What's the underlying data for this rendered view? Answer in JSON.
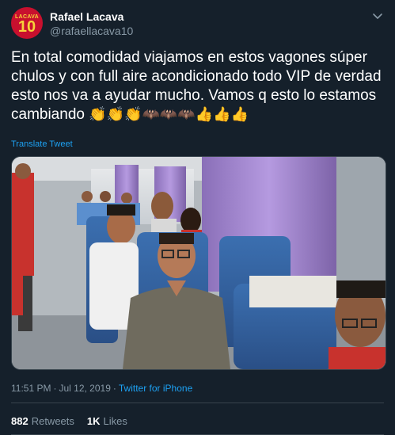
{
  "author": {
    "display_name": "Rafael Lacava",
    "handle": "@rafaellacava10",
    "avatar_text_top": "LACAVA",
    "avatar_text_number": "10"
  },
  "tweet": {
    "text": "En total comodidad viajamos en estos vagones súper chulos y con full aire acondicionado todo VIP de verdad esto nos va a ayudar mucho. Vamos q esto lo estamos cambiando",
    "emojis": [
      "clapping-hands-emoji",
      "clapping-hands-emoji",
      "clapping-hands-emoji",
      "bat-emoji",
      "bat-emoji",
      "bat-emoji",
      "thumbs-up-emoji",
      "thumbs-up-emoji",
      "thumbs-up-emoji"
    ],
    "translate_label": "Translate Tweet",
    "media_description_icon": "video-still-train-passengers"
  },
  "meta": {
    "time": "11:51 PM",
    "separator": "·",
    "date": "Jul 12, 2019",
    "source": "Twitter for iPhone"
  },
  "stats": {
    "retweets_count": "882",
    "retweets_label": "Retweets",
    "likes_count": "1K",
    "likes_label": "Likes"
  },
  "colors": {
    "background": "#15202b",
    "text_primary": "#ffffff",
    "text_secondary": "#8899a6",
    "link": "#1da1f2",
    "border": "#38444d"
  }
}
